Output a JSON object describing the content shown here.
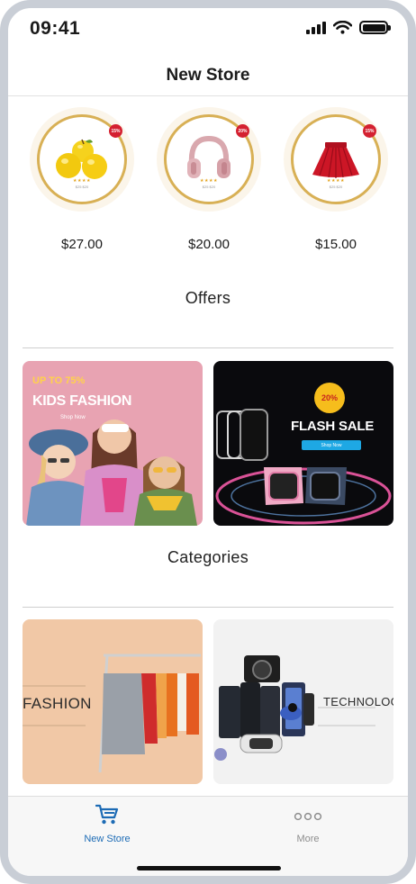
{
  "status_bar": {
    "time": "09:41"
  },
  "nav": {
    "title": "New Store"
  },
  "products": [
    {
      "name": "apples",
      "price": "$27.00",
      "badge": "15%",
      "stars": "★★★★",
      "mini_price": "$25  $20"
    },
    {
      "name": "headphones",
      "price": "$20.00",
      "badge": "20%",
      "stars": "★★★★",
      "mini_price": "$25  $20"
    },
    {
      "name": "skirt",
      "price": "$15.00",
      "badge": "15%",
      "stars": "★★★★",
      "mini_price": "$25  $20"
    }
  ],
  "offers": {
    "title": "Offers",
    "banners": [
      {
        "headline": "UP TO 75%",
        "title": "KIDS FASHION",
        "cta": "Shop Now"
      },
      {
        "badge": "20%",
        "title": "FLASH SALE",
        "cta": "Shop Now"
      }
    ]
  },
  "categories": {
    "title": "Categories",
    "items": [
      {
        "label": "FASHION"
      },
      {
        "label": "TECHNOLOG"
      }
    ]
  },
  "tab_bar": {
    "tabs": [
      {
        "label": "New Store",
        "icon": "cart-icon",
        "active": true
      },
      {
        "label": "More",
        "icon": "more-icon",
        "active": false
      }
    ]
  },
  "colors": {
    "accent": "#1c6bb5",
    "gold_ring": "#d8b055",
    "kids_banner_bg": "#e8a3b2",
    "flash_banner_bg": "#0a0a0d",
    "fashion_bg": "#f1c8a6"
  }
}
